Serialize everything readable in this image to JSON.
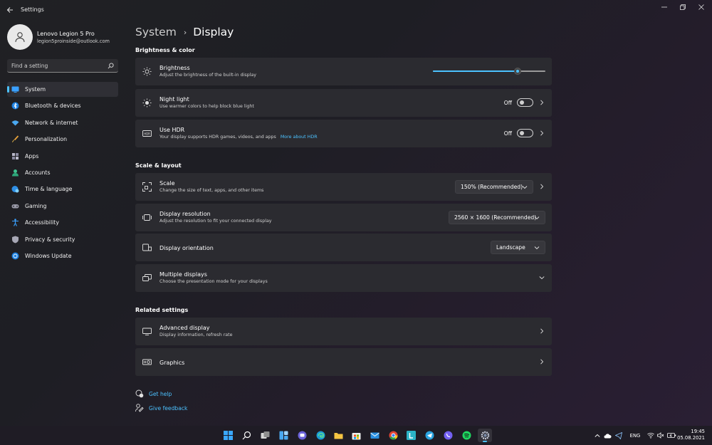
{
  "window": {
    "title": "Settings"
  },
  "profile": {
    "name": "Lenovo Legion 5 Pro",
    "email": "legion5proinside@outlook.com"
  },
  "search": {
    "placeholder": "Find a setting"
  },
  "sidebar": {
    "items": [
      {
        "label": "System",
        "icon": "system-icon",
        "active": true
      },
      {
        "label": "Bluetooth & devices",
        "icon": "bluetooth-icon"
      },
      {
        "label": "Network & internet",
        "icon": "wifi-icon"
      },
      {
        "label": "Personalization",
        "icon": "brush-icon"
      },
      {
        "label": "Apps",
        "icon": "apps-icon"
      },
      {
        "label": "Accounts",
        "icon": "accounts-icon"
      },
      {
        "label": "Time & language",
        "icon": "globe-clock-icon"
      },
      {
        "label": "Gaming",
        "icon": "gamepad-icon"
      },
      {
        "label": "Accessibility",
        "icon": "accessibility-icon"
      },
      {
        "label": "Privacy & security",
        "icon": "shield-icon"
      },
      {
        "label": "Windows Update",
        "icon": "update-icon"
      }
    ]
  },
  "breadcrumb": {
    "parent": "System",
    "separator": "›",
    "current": "Display"
  },
  "sections": {
    "brightness_color": "Brightness & color",
    "scale_layout": "Scale & layout",
    "related": "Related settings"
  },
  "cards": {
    "brightness": {
      "title": "Brightness",
      "subtitle": "Adjust the brightness of the built-in display",
      "value_percent": 75
    },
    "night_light": {
      "title": "Night light",
      "subtitle": "Use warmer colors to help block blue light",
      "state": "Off"
    },
    "hdr": {
      "title": "Use HDR",
      "subtitle": "Your display supports HDR games, videos, and apps",
      "link": "More about HDR",
      "state": "Off"
    },
    "scale": {
      "title": "Scale",
      "subtitle": "Change the size of text, apps, and other items",
      "value": "150% (Recommended)"
    },
    "resolution": {
      "title": "Display resolution",
      "subtitle": "Adjust the resolution to fit your connected display",
      "value": "2560 × 1600 (Recommended)"
    },
    "orientation": {
      "title": "Display orientation",
      "value": "Landscape"
    },
    "multiple": {
      "title": "Multiple displays",
      "subtitle": "Choose the presentation mode for your displays"
    },
    "advanced": {
      "title": "Advanced display",
      "subtitle": "Display information, refresh rate"
    },
    "graphics": {
      "title": "Graphics"
    }
  },
  "help": {
    "get_help": "Get help",
    "feedback": "Give feedback"
  },
  "taskbar": {
    "language": "ENG",
    "time": "19:45",
    "date": "05.08.2021"
  },
  "colors": {
    "accent": "#4cc2ff",
    "card": "#2b2b30"
  }
}
